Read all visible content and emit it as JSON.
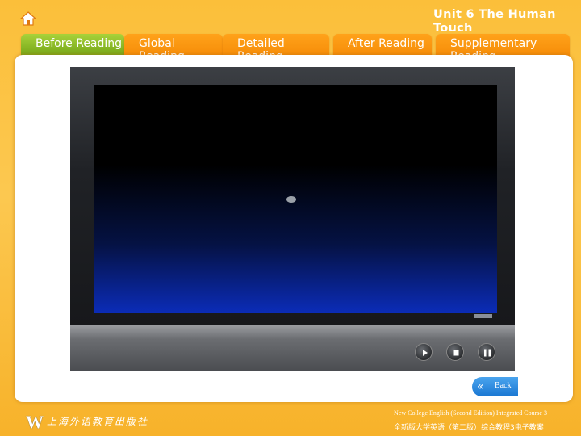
{
  "header": {
    "unit_title": "Unit 6 The Human Touch"
  },
  "tabs": [
    {
      "label": "Before Reading",
      "active": true
    },
    {
      "label": "Global Reading",
      "active": false
    },
    {
      "label": "Detailed Reading",
      "active": false
    },
    {
      "label": "After Reading",
      "active": false
    },
    {
      "label": "Supplementary Reading",
      "active": false
    }
  ],
  "player": {
    "controls": [
      "play-icon",
      "stop-icon",
      "pause-icon"
    ]
  },
  "navigation": {
    "back_label": "Back"
  },
  "footer": {
    "logo_letter": "W",
    "publisher": "上海外语教育出版社",
    "course_en": "New College English (Second Edition) Integrated Course 3",
    "course_cn": "全新版大学英语（第二版）综合教程3电子教案"
  },
  "colors": {
    "background": "#fbbf3a",
    "tab_orange": "#f58a06",
    "tab_active_green": "#6fa114",
    "back_button_blue": "#1a77d2"
  }
}
